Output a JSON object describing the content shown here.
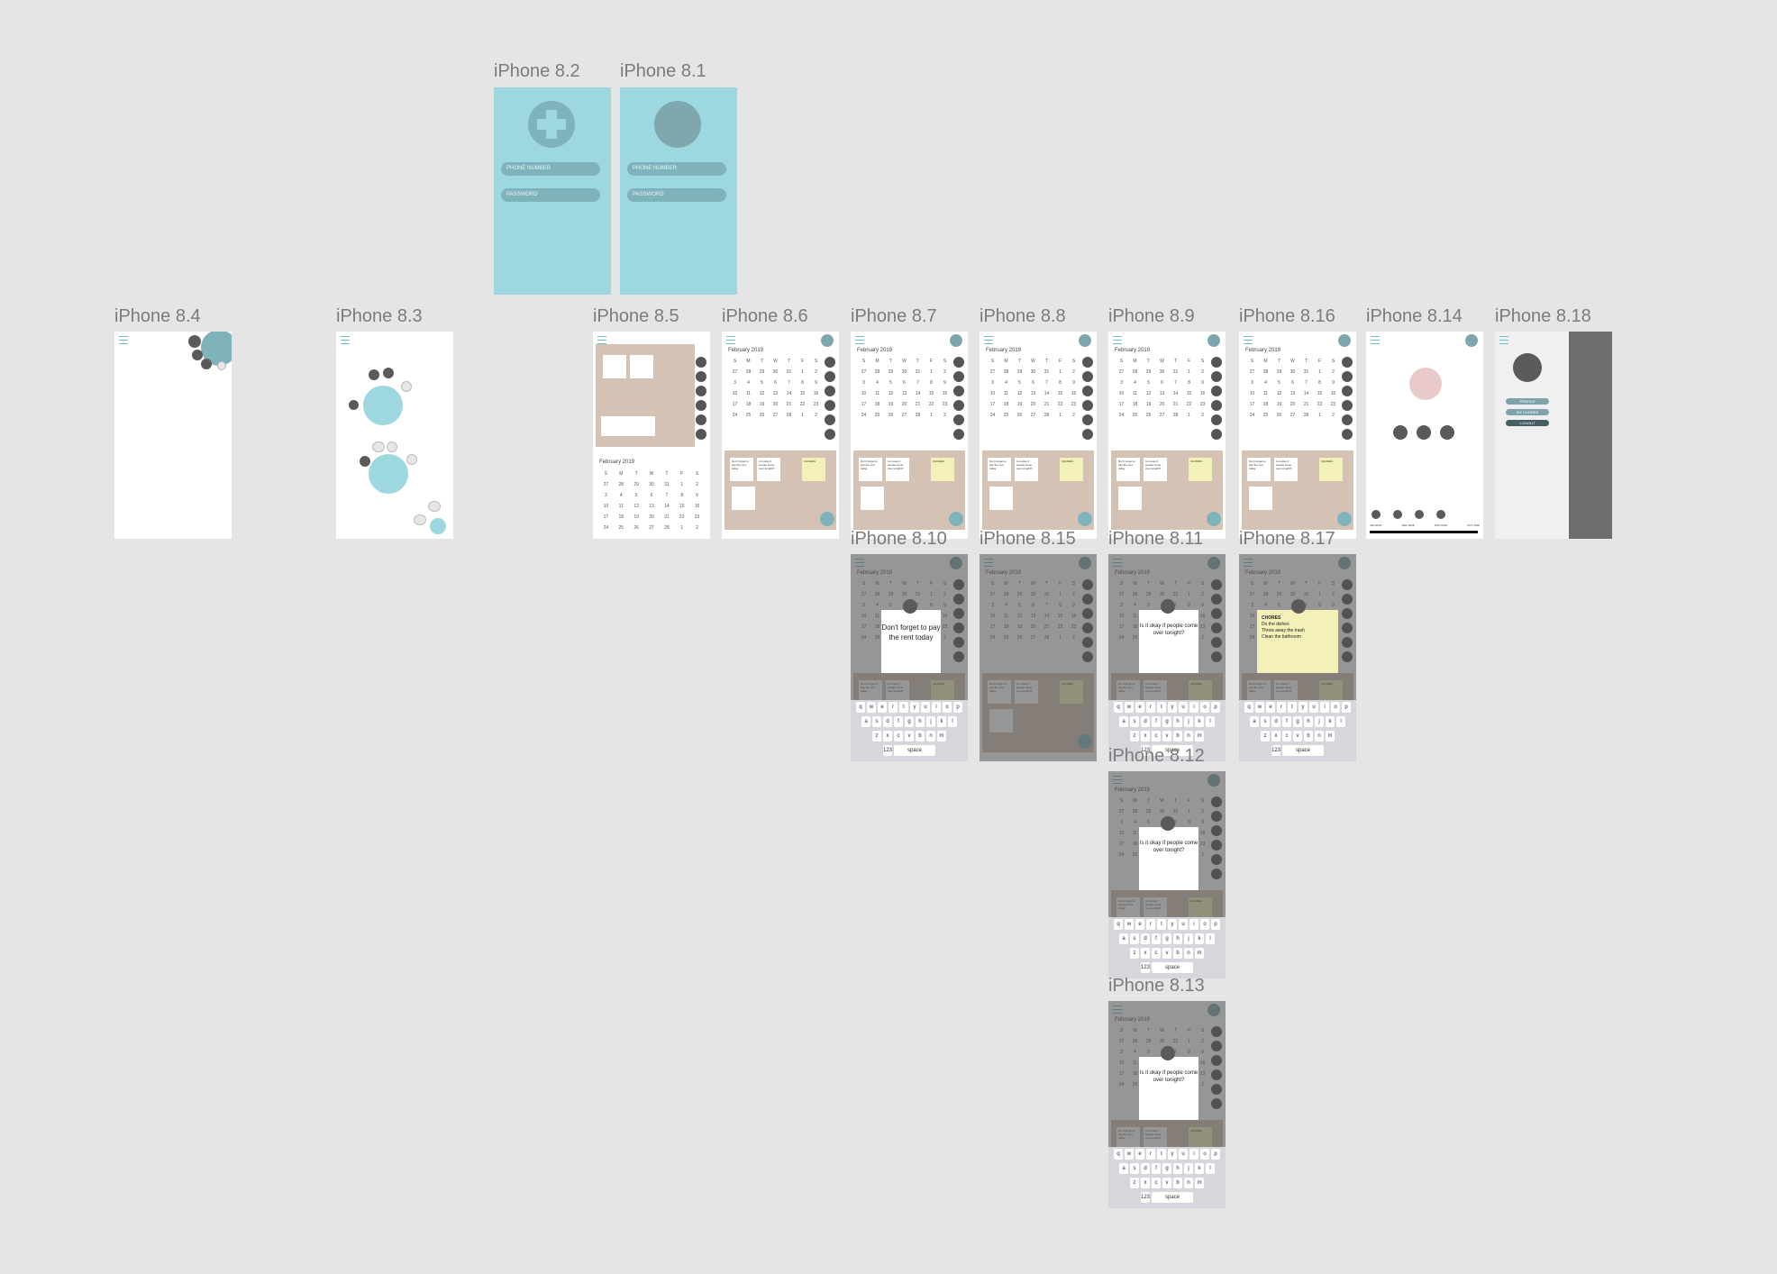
{
  "frames": [
    {
      "id": "f82",
      "label": "iPhone 8.2"
    },
    {
      "id": "f81",
      "label": "iPhone 8.1"
    },
    {
      "id": "f84",
      "label": "iPhone 8.4"
    },
    {
      "id": "f83",
      "label": "iPhone 8.3"
    },
    {
      "id": "f85",
      "label": "iPhone 8.5"
    },
    {
      "id": "f86",
      "label": "iPhone 8.6"
    },
    {
      "id": "f87",
      "label": "iPhone 8.7"
    },
    {
      "id": "f88",
      "label": "iPhone 8.8"
    },
    {
      "id": "f89",
      "label": "iPhone 8.9"
    },
    {
      "id": "f816",
      "label": "iPhone 8.16"
    },
    {
      "id": "f814",
      "label": "iPhone 8.14"
    },
    {
      "id": "f818",
      "label": "iPhone 8.18"
    },
    {
      "id": "f810",
      "label": "iPhone 8.10"
    },
    {
      "id": "f815",
      "label": "iPhone 8.15"
    },
    {
      "id": "f811",
      "label": "iPhone 8.11"
    },
    {
      "id": "f817",
      "label": "iPhone 8.17"
    },
    {
      "id": "f812",
      "label": "iPhone 8.12"
    },
    {
      "id": "f813",
      "label": "iPhone 8.13"
    }
  ],
  "login": {
    "phone_placeholder": "PHONE NUMBER",
    "password_placeholder": "PASSWORD"
  },
  "calendar": {
    "month": "February 2019",
    "weekdays": [
      "S",
      "M",
      "T",
      "W",
      "T",
      "F",
      "S"
    ],
    "days": [
      "27",
      "28",
      "29",
      "30",
      "31",
      "1",
      "2",
      "3",
      "4",
      "5",
      "6",
      "7",
      "8",
      "9",
      "10",
      "11",
      "12",
      "13",
      "14",
      "15",
      "16",
      "17",
      "18",
      "19",
      "20",
      "21",
      "22",
      "23",
      "24",
      "25",
      "26",
      "27",
      "28",
      "1",
      "2"
    ]
  },
  "notes": {
    "rent": "Don't forget to pay the rent today",
    "people": "Is it okay if people come over tonight?",
    "chores_title": "CHORES",
    "chores_items": [
      "Do the dishes",
      "Throw away the trash",
      "Clean the bathroom"
    ]
  },
  "profile": {
    "menu": [
      "PROFILE",
      "MY CHORES",
      "LOGOUT"
    ],
    "timeline": [
      "JAN 2019",
      "DEC 2018",
      "NOV 2018",
      "OCT 2018"
    ]
  },
  "keyboard": {
    "row1": [
      "q",
      "w",
      "e",
      "r",
      "t",
      "y",
      "u",
      "i",
      "o",
      "p"
    ],
    "row2": [
      "a",
      "s",
      "d",
      "f",
      "g",
      "h",
      "j",
      "k",
      "l"
    ],
    "row3": [
      "z",
      "x",
      "c",
      "v",
      "b",
      "n",
      "m"
    ],
    "space": "space",
    "num": "123"
  },
  "colors": {
    "background": "#e5e5e5",
    "teal": "#9dd7e0",
    "board": "#d4c2b4",
    "note_yellow": "#f3f0b8"
  }
}
